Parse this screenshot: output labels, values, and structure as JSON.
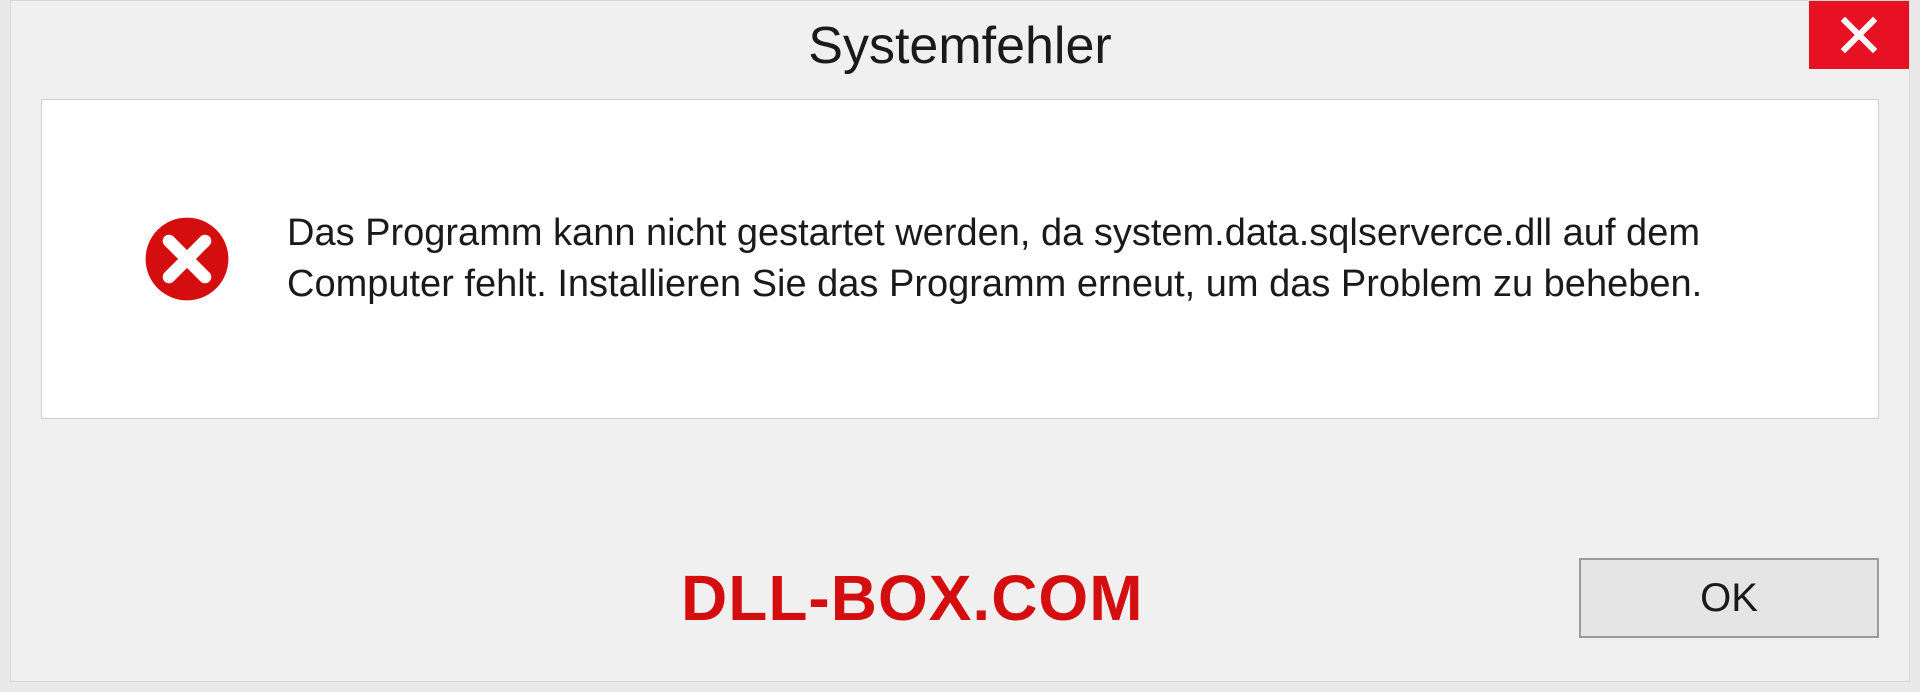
{
  "dialog": {
    "title": "Systemfehler",
    "message": "Das Programm kann nicht gestartet werden, da system.data.sqlserverce.dll auf dem Computer fehlt. Installieren Sie das Programm erneut, um das Problem zu beheben.",
    "ok_label": "OK"
  },
  "watermark": "DLL-BOX.COM",
  "colors": {
    "close_bg": "#e81123",
    "error_red": "#d40e0e",
    "watermark_red": "#d40e0e"
  }
}
